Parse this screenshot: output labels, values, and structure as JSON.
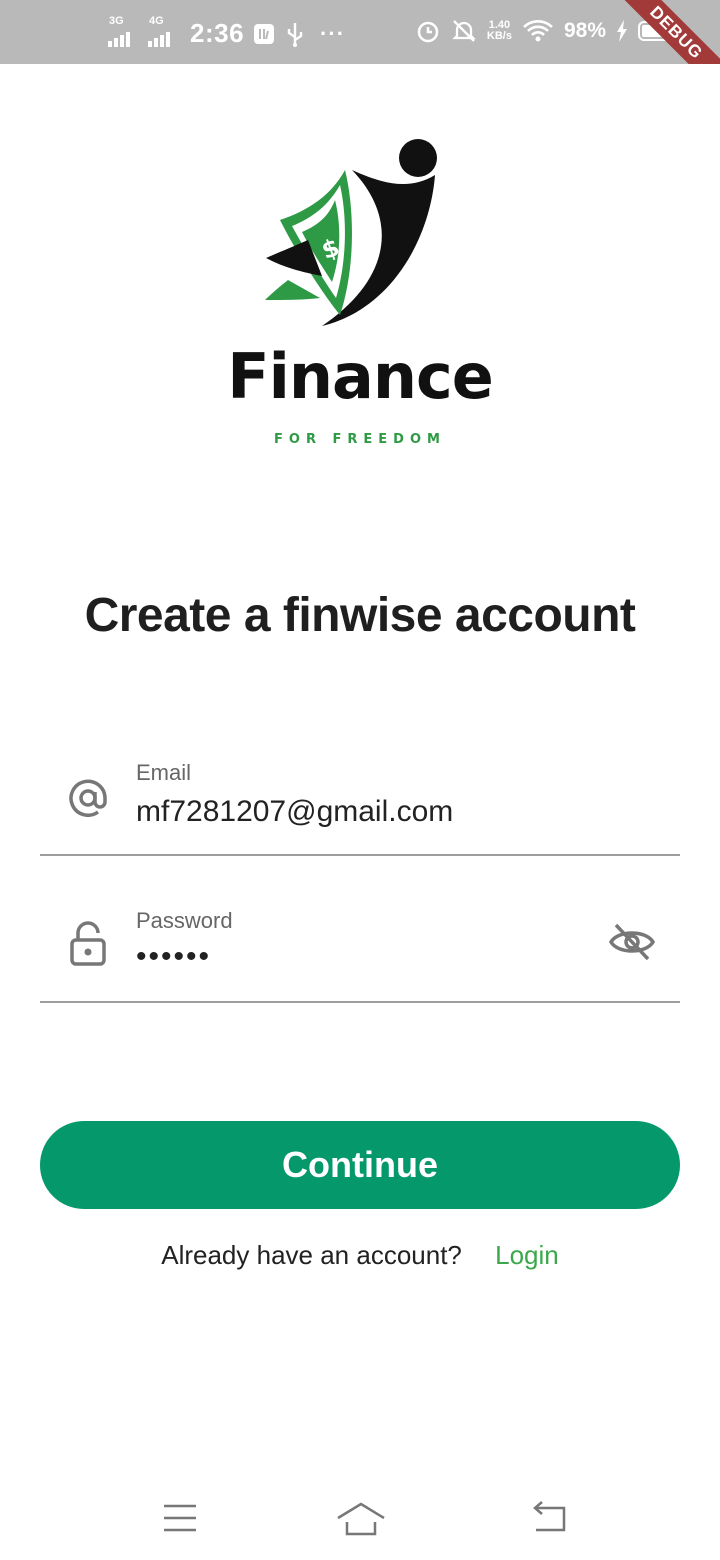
{
  "status_bar": {
    "net1": "3G",
    "net2": "4G",
    "time": "2:36",
    "speed_value": "1.40",
    "speed_unit": "KB/s",
    "battery_percent": "98%",
    "battery_level": 0.98,
    "debug_label": "DEBUG",
    "icons": [
      "signal-icon",
      "usb-debug-icon",
      "usb-icon",
      "more-icon",
      "alarm-icon",
      "bell-off-icon",
      "wifi-icon",
      "charging-icon",
      "battery-icon"
    ]
  },
  "logo": {
    "brand": "Finance",
    "tagline": "FOR FREEDOM",
    "colors": {
      "green": "#2e9a45",
      "black": "#111111"
    }
  },
  "title": "Create a finwise account",
  "form": {
    "email": {
      "label": "Email",
      "value": "mf7281207@gmail.com",
      "icon": "at-icon"
    },
    "password": {
      "label": "Password",
      "value": "••••••",
      "icon": "lock-icon",
      "toggle_icon": "eye-off-icon"
    }
  },
  "continue_label": "Continue",
  "login_prompt": "Already have an account?",
  "login_link": "Login",
  "accent_color": "#04986b",
  "link_color": "#3aa84b",
  "nav": {
    "icons": [
      "menu-icon",
      "home-icon",
      "back-icon"
    ]
  }
}
